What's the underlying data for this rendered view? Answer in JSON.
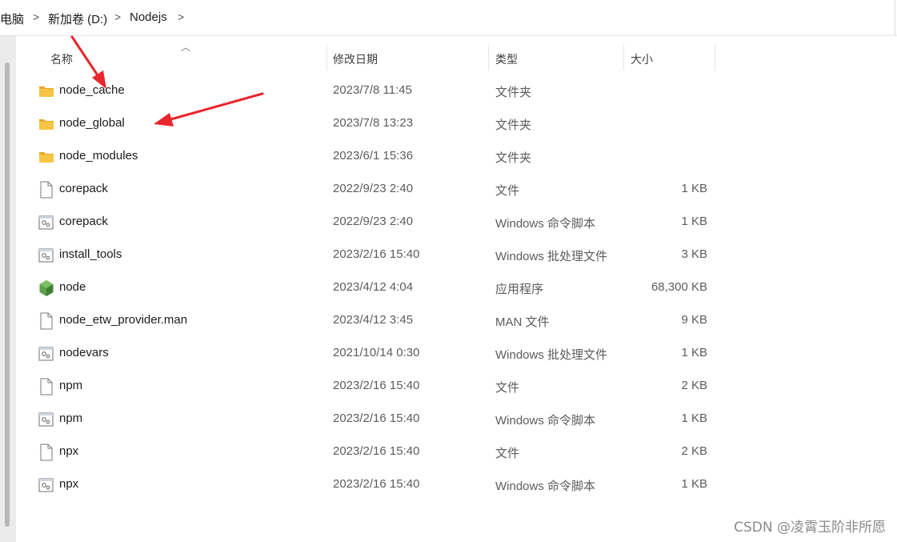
{
  "breadcrumb": {
    "items": [
      "此电脑",
      "新加卷 (D:)",
      "Nodejs"
    ],
    "separator": ">"
  },
  "columns": {
    "name": "名称",
    "date": "修改日期",
    "type": "类型",
    "size": "大小"
  },
  "files": [
    {
      "name": "node_cache",
      "date": "2023/7/8 11:45",
      "type": "文件夹",
      "size": "",
      "icon": "folder-icon"
    },
    {
      "name": "node_global",
      "date": "2023/7/8 13:23",
      "type": "文件夹",
      "size": "",
      "icon": "folder-icon"
    },
    {
      "name": "node_modules",
      "date": "2023/6/1 15:36",
      "type": "文件夹",
      "size": "",
      "icon": "folder-icon"
    },
    {
      "name": "corepack",
      "date": "2022/9/23 2:40",
      "type": "文件",
      "size": "1 KB",
      "icon": "file-icon"
    },
    {
      "name": "corepack",
      "date": "2022/9/23 2:40",
      "type": "Windows 命令脚本",
      "size": "1 KB",
      "icon": "script-icon"
    },
    {
      "name": "install_tools",
      "date": "2023/2/16 15:40",
      "type": "Windows 批处理文件",
      "size": "3 KB",
      "icon": "script-icon"
    },
    {
      "name": "node",
      "date": "2023/4/12 4:04",
      "type": "应用程序",
      "size": "68,300 KB",
      "icon": "nodejs-icon"
    },
    {
      "name": "node_etw_provider.man",
      "date": "2023/4/12 3:45",
      "type": "MAN 文件",
      "size": "9 KB",
      "icon": "file-icon"
    },
    {
      "name": "nodevars",
      "date": "2021/10/14 0:30",
      "type": "Windows 批处理文件",
      "size": "1 KB",
      "icon": "script-icon"
    },
    {
      "name": "npm",
      "date": "2023/2/16 15:40",
      "type": "文件",
      "size": "2 KB",
      "icon": "file-icon"
    },
    {
      "name": "npm",
      "date": "2023/2/16 15:40",
      "type": "Windows 命令脚本",
      "size": "1 KB",
      "icon": "script-icon"
    },
    {
      "name": "npx",
      "date": "2023/2/16 15:40",
      "type": "文件",
      "size": "2 KB",
      "icon": "file-icon"
    },
    {
      "name": "npx",
      "date": "2023/2/16 15:40",
      "type": "Windows 命令脚本",
      "size": "1 KB",
      "icon": "script-icon"
    }
  ],
  "watermark": "CSDN @凌霄玉阶非所愿",
  "colors": {
    "folder": "#f6c544",
    "folder_dark": "#e9a825",
    "nodejs": "#5fa04e",
    "arrow": "#e8262b"
  }
}
